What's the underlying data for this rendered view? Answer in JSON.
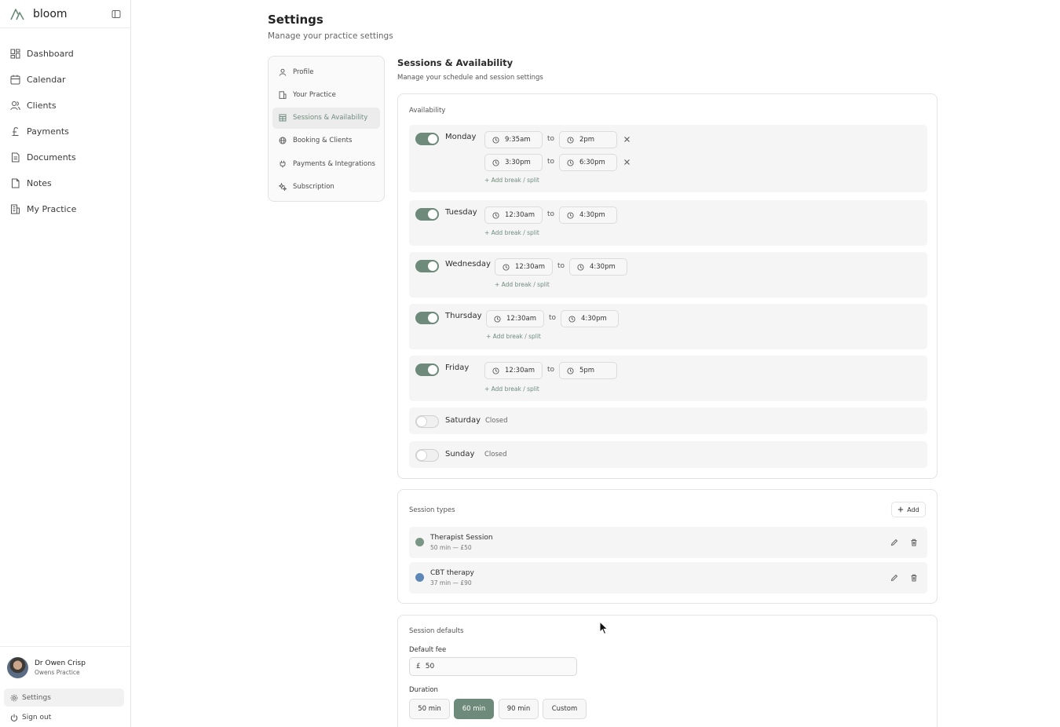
{
  "brand": {
    "name": "bloom"
  },
  "nav": [
    {
      "id": "dashboard",
      "label": "Dashboard",
      "icon": "dashboard-grid-icon"
    },
    {
      "id": "calendar",
      "label": "Calendar",
      "icon": "calendar-icon"
    },
    {
      "id": "clients",
      "label": "Clients",
      "icon": "users-icon"
    },
    {
      "id": "payments",
      "label": "Payments",
      "icon": "pound-icon"
    },
    {
      "id": "documents",
      "label": "Documents",
      "icon": "document-icon"
    },
    {
      "id": "notes",
      "label": "Notes",
      "icon": "note-icon"
    },
    {
      "id": "my-practice",
      "label": "My Practice",
      "icon": "building-icon"
    }
  ],
  "user": {
    "name": "Dr Owen Crisp",
    "practice": "Owens Practice"
  },
  "footer": {
    "settings_label": "Settings",
    "signout_label": "Sign out"
  },
  "page": {
    "title": "Settings",
    "subtitle": "Manage your practice settings"
  },
  "subnav": [
    {
      "label": "Profile",
      "icon": "user-icon",
      "active": false
    },
    {
      "label": "Your Practice",
      "icon": "building-icon",
      "active": false
    },
    {
      "label": "Sessions & Availability",
      "icon": "calendar-grid-icon",
      "active": true
    },
    {
      "label": "Booking & Clients",
      "icon": "globe-icon",
      "active": false
    },
    {
      "label": "Payments & Integrations",
      "icon": "plug-icon",
      "active": false
    },
    {
      "label": "Subscription",
      "icon": "sparkle-icon",
      "active": false
    }
  ],
  "section": {
    "title": "Sessions & Availability",
    "subtitle": "Manage your schedule and session settings"
  },
  "availability": {
    "label": "Availability",
    "to_label": "to",
    "add_break_label": "+ Add break / split",
    "closed_label": "Closed",
    "days": [
      {
        "name": "Monday",
        "enabled": true,
        "ranges": [
          {
            "start": "9:35am",
            "end": "2pm"
          },
          {
            "start": "3:30pm",
            "end": "6:30pm"
          }
        ]
      },
      {
        "name": "Tuesday",
        "enabled": true,
        "ranges": [
          {
            "start": "12:30am",
            "end": "4:30pm"
          }
        ]
      },
      {
        "name": "Wednesday",
        "enabled": true,
        "ranges": [
          {
            "start": "12:30am",
            "end": "4:30pm"
          }
        ]
      },
      {
        "name": "Thursday",
        "enabled": true,
        "ranges": [
          {
            "start": "12:30am",
            "end": "4:30pm"
          }
        ]
      },
      {
        "name": "Friday",
        "enabled": true,
        "ranges": [
          {
            "start": "12:30am",
            "end": "5pm"
          }
        ]
      },
      {
        "name": "Saturday",
        "enabled": false,
        "ranges": []
      },
      {
        "name": "Sunday",
        "enabled": false,
        "ranges": []
      }
    ]
  },
  "session_types": {
    "label": "Session types",
    "add_label": "Add",
    "items": [
      {
        "name": "Therapist Session",
        "detail": "50 min — £50",
        "color": "#7a9686"
      },
      {
        "name": "CBT therapy",
        "detail": "37 min — £90",
        "color": "#5d87b7"
      }
    ]
  },
  "session_defaults": {
    "label": "Session defaults",
    "fee_label": "Default fee",
    "currency": "£",
    "fee_value": "50",
    "duration_label": "Duration",
    "durations": [
      {
        "label": "50 min",
        "selected": false
      },
      {
        "label": "60 min",
        "selected": true
      },
      {
        "label": "90 min",
        "selected": false
      },
      {
        "label": "Custom",
        "selected": false
      }
    ]
  },
  "colors": {
    "accent": "#6d8a7b",
    "accent_text": "#6e8c7e",
    "panel": "#f5f5f5"
  }
}
